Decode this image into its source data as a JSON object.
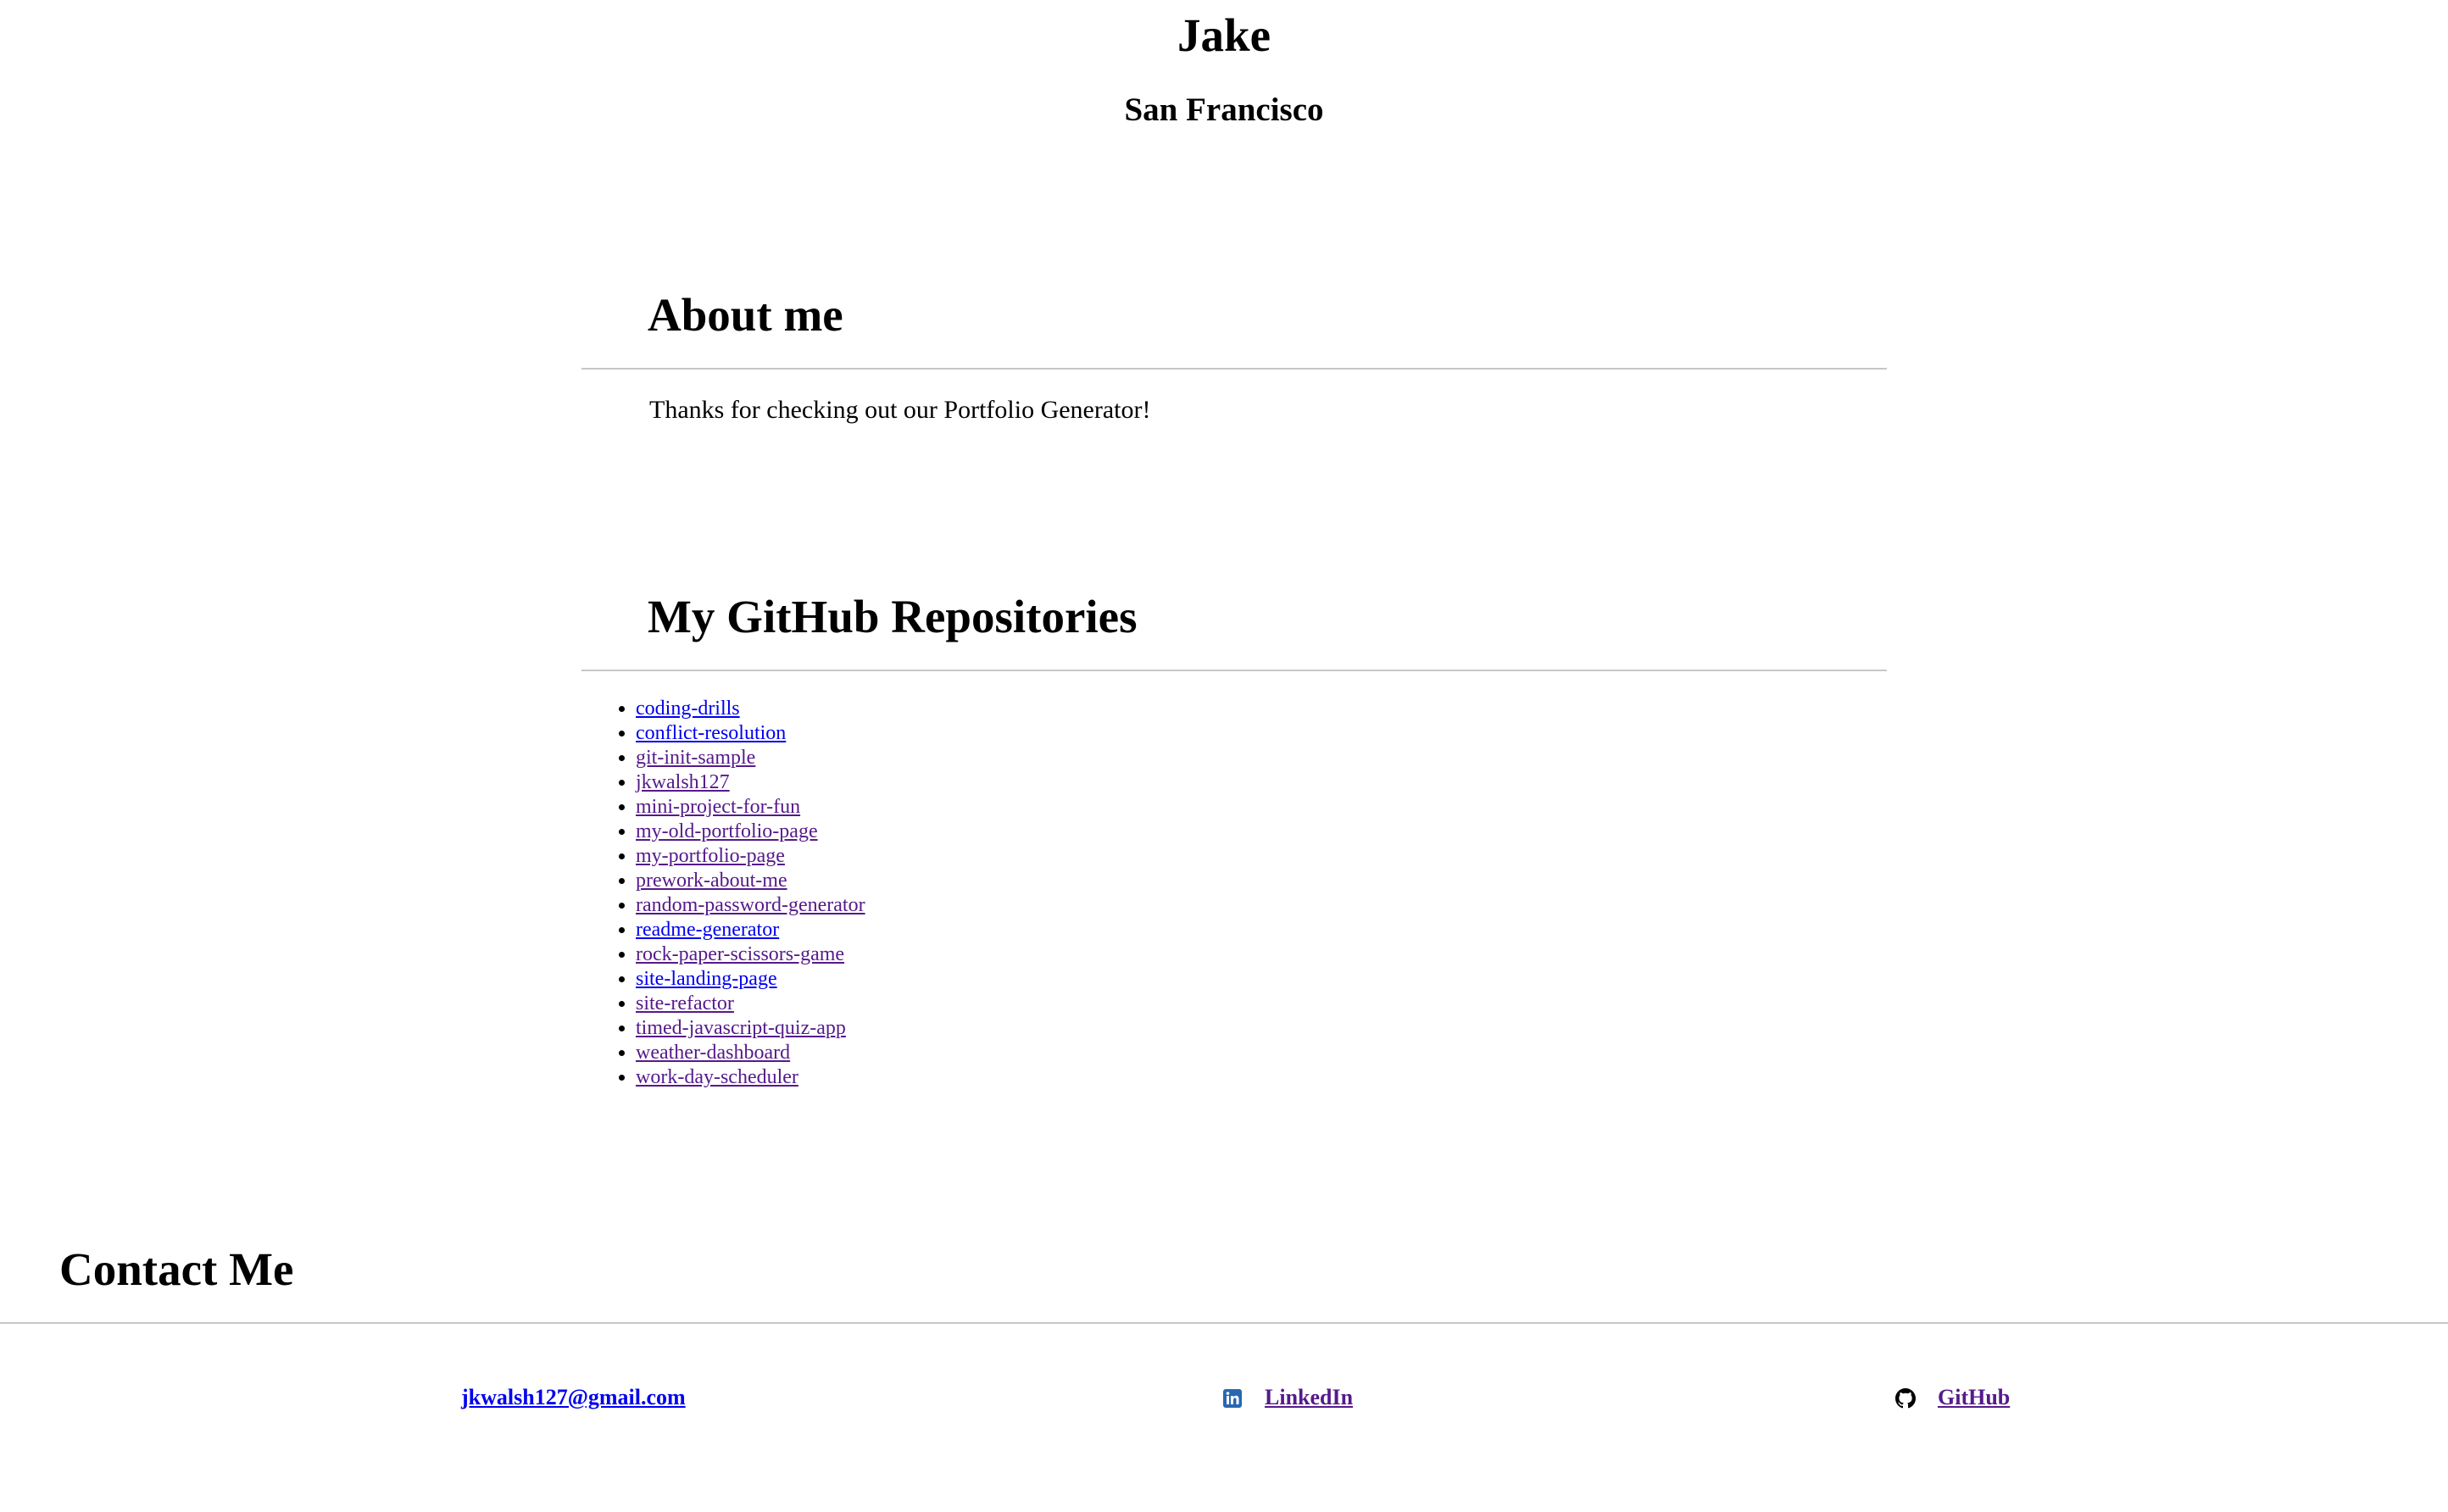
{
  "header": {
    "name": "Jake",
    "city": "San Francisco"
  },
  "about": {
    "title": "About me",
    "text": "Thanks for checking out our Portfolio Generator!"
  },
  "repos": {
    "title": "My GitHub Repositories",
    "items": [
      {
        "label": "coding-drills",
        "visited": false
      },
      {
        "label": "conflict-resolution",
        "visited": false
      },
      {
        "label": "git-init-sample",
        "visited": true
      },
      {
        "label": "jkwalsh127",
        "visited": true
      },
      {
        "label": "mini-project-for-fun",
        "visited": true
      },
      {
        "label": "my-old-portfolio-page",
        "visited": true
      },
      {
        "label": "my-portfolio-page",
        "visited": true
      },
      {
        "label": "prework-about-me",
        "visited": true
      },
      {
        "label": "random-password-generator",
        "visited": true
      },
      {
        "label": "readme-generator",
        "visited": false
      },
      {
        "label": "rock-paper-scissors-game",
        "visited": true
      },
      {
        "label": "site-landing-page",
        "visited": false
      },
      {
        "label": "site-refactor",
        "visited": true
      },
      {
        "label": "timed-javascript-quiz-app",
        "visited": true
      },
      {
        "label": "weather-dashboard",
        "visited": true
      },
      {
        "label": "work-day-scheduler",
        "visited": true
      }
    ]
  },
  "contact": {
    "title": "Contact Me",
    "email": "jkwalsh127@gmail.com",
    "linkedin": "LinkedIn",
    "github": "GitHub",
    "linkedin_icon": "linkedin-icon",
    "github_icon": "github-icon"
  },
  "colors": {
    "link": "#0000ee",
    "visited_link": "#551a8b",
    "rule": "#c6c6c6",
    "linkedin_brand": "#2867b2"
  }
}
